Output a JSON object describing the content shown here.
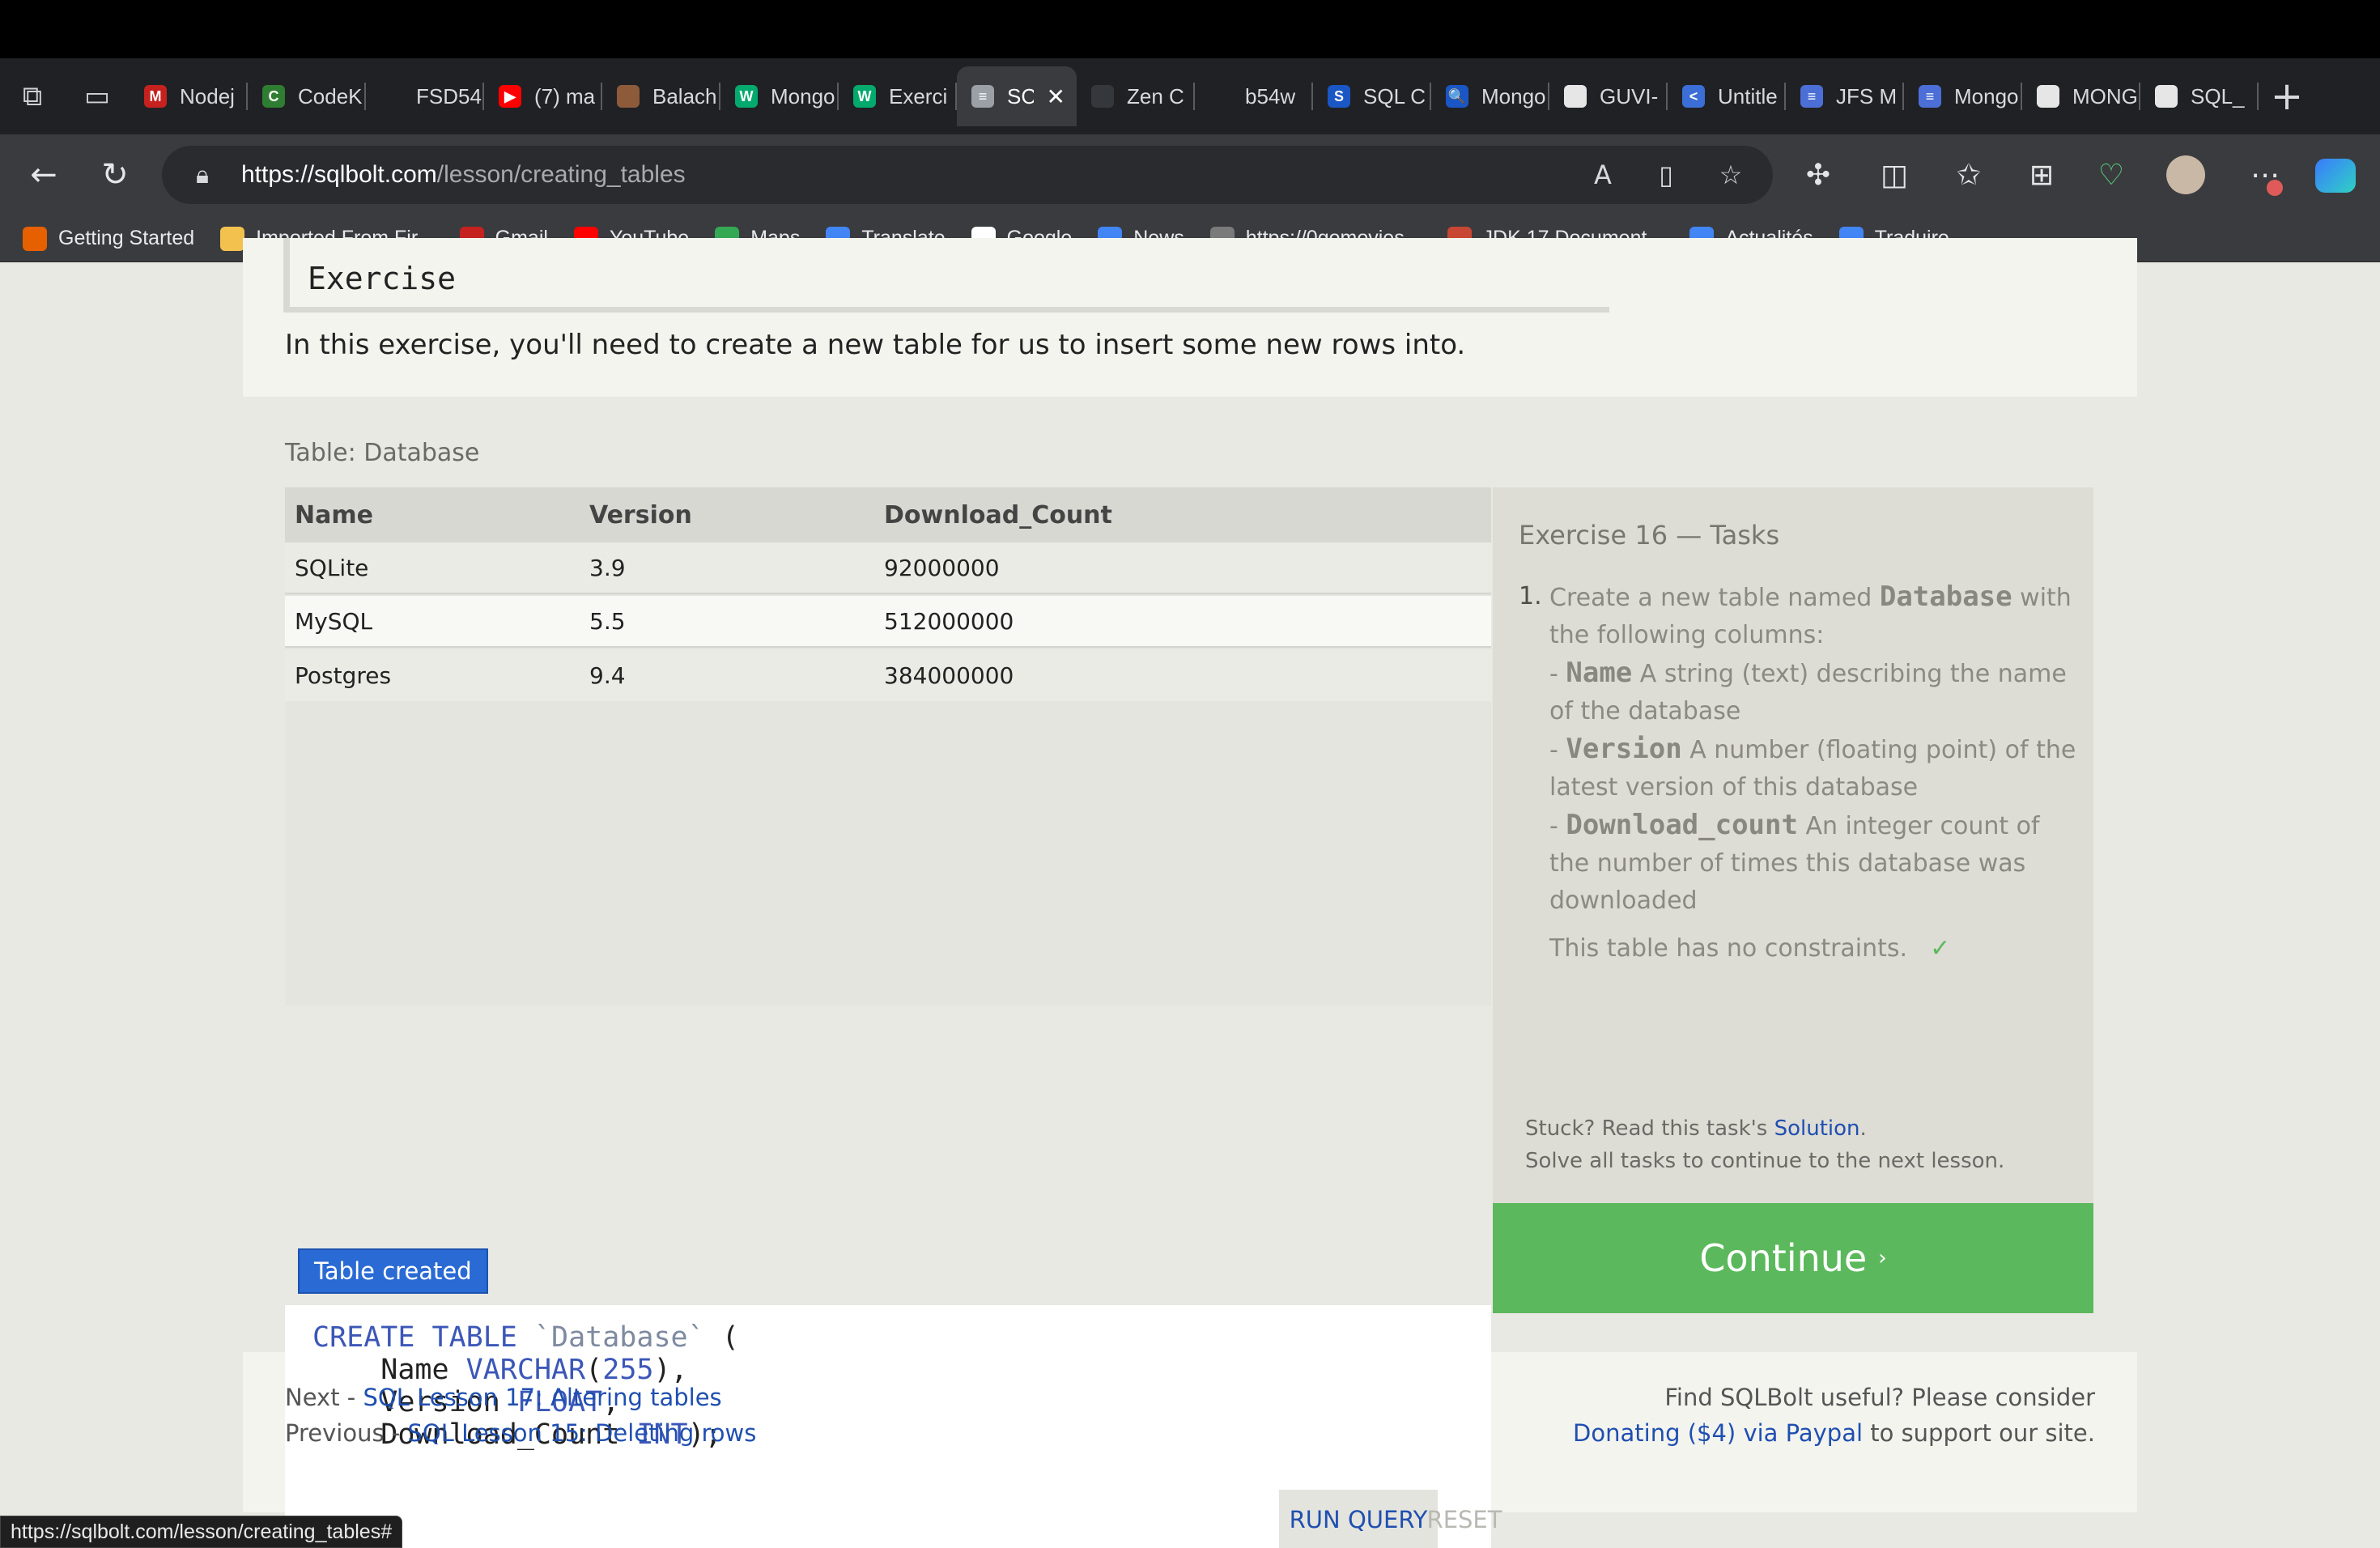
{
  "browser": {
    "tabs": [
      {
        "label": "Nodej",
        "icon": "gmail-icon",
        "color": "#c5221f",
        "glyph": "M"
      },
      {
        "label": "CodeK",
        "icon": "codekata-icon",
        "color": "#2f7d32",
        "glyph": "C"
      },
      {
        "label": "FSD54",
        "icon": "github-icon",
        "color": "#202124",
        "glyph": ""
      },
      {
        "label": "(7) ma",
        "icon": "youtube-icon",
        "color": "#ff0000",
        "glyph": "▶"
      },
      {
        "label": "Balach",
        "icon": "profile-icon",
        "color": "#8d5b3a",
        "glyph": ""
      },
      {
        "label": "Mongo",
        "icon": "w3-icon",
        "color": "#04aa6d",
        "glyph": "W"
      },
      {
        "label": "Exerci",
        "icon": "w3-icon",
        "color": "#04aa6d",
        "glyph": "W"
      },
      {
        "label": "SC",
        "icon": "database-icon",
        "color": "#9aa0a6",
        "glyph": "≡",
        "active": true
      },
      {
        "label": "Zen C",
        "icon": "zen-icon",
        "color": "#34373b",
        "glyph": ""
      },
      {
        "label": "b54w",
        "icon": "github-icon",
        "color": "#202124",
        "glyph": ""
      },
      {
        "label": "SQL C",
        "icon": "sql-icon",
        "color": "#1a56c4",
        "glyph": "S"
      },
      {
        "label": "Mongo",
        "icon": "search-icon",
        "color": "#1a56c4",
        "glyph": "🔍"
      },
      {
        "label": "GUVI-",
        "icon": "github-icon",
        "color": "#e6e6e6",
        "glyph": ""
      },
      {
        "label": "Untitle",
        "icon": "share-icon",
        "color": "#3b6ed6",
        "glyph": "<"
      },
      {
        "label": "JFS M",
        "icon": "docs-icon",
        "color": "#4b6fd6",
        "glyph": "≡"
      },
      {
        "label": "Mongo",
        "icon": "docs-icon",
        "color": "#4b6fd6",
        "glyph": "≡"
      },
      {
        "label": "MONG",
        "icon": "github-icon",
        "color": "#e6e6e6",
        "glyph": ""
      },
      {
        "label": "SQL_",
        "icon": "github-icon",
        "color": "#e6e6e6",
        "glyph": ""
      }
    ],
    "url_host": "https://sqlbolt.com",
    "url_path": "/lesson/creating_tables",
    "bookmarks": [
      {
        "label": "Getting Started",
        "icon": "firefox-icon",
        "color": "#e66000"
      },
      {
        "label": "Imported From Fir...",
        "icon": "folder-icon",
        "color": "#f2c14e"
      },
      {
        "label": "Gmail",
        "icon": "gmail-icon",
        "color": "#c5221f"
      },
      {
        "label": "YouTube",
        "icon": "youtube-icon",
        "color": "#ff0000"
      },
      {
        "label": "Maps",
        "icon": "maps-icon",
        "color": "#34a853"
      },
      {
        "label": "Translate",
        "icon": "translate-icon",
        "color": "#4285f4"
      },
      {
        "label": "Google",
        "icon": "google-icon",
        "color": "#ffffff"
      },
      {
        "label": "News",
        "icon": "news-icon",
        "color": "#4285f4"
      },
      {
        "label": "https://0gomovies...",
        "icon": "gomovies-icon",
        "color": "#7a7a7a"
      },
      {
        "label": "JDK 17 Document...",
        "icon": "oracle-icon",
        "color": "#c74634"
      },
      {
        "label": "Actualités",
        "icon": "news-icon",
        "color": "#4285f4"
      },
      {
        "label": "Traduire",
        "icon": "translate-icon",
        "color": "#4285f4"
      }
    ],
    "status_url": "https://sqlbolt.com/lesson/creating_tables#"
  },
  "exercise": {
    "heading": "Exercise",
    "intro": "In this exercise, you'll need to create a new table for us to insert some new rows into.",
    "table_caption": "Table: Database",
    "columns": [
      "Name",
      "Version",
      "Download_Count"
    ],
    "rows": [
      [
        "SQLite",
        "3.9",
        "92000000"
      ],
      [
        "MySQL",
        "5.5",
        "512000000"
      ],
      [
        "Postgres",
        "9.4",
        "384000000"
      ]
    ],
    "status": "Table created",
    "run_label": "RUN QUERY",
    "reset_label": "RESET"
  },
  "tasks": {
    "title": "Exercise 16 — Tasks",
    "task1_num": "1.",
    "task1_pre": "Create a new table named ",
    "task1_name": "Database",
    "task1_post": " with the following columns:",
    "col1_name": "Name",
    "col1_desc": " A string (text) describing the name of the database",
    "col2_name": "Version",
    "col2_desc": " A number (floating point) of the latest version of this database",
    "col3_name": "Download_count",
    "col3_desc": " An integer count of the number of times this database was downloaded",
    "task2": "This table has no constraints.",
    "check": "✓",
    "stuck_pre": "Stuck? Read this task's ",
    "stuck_link": "Solution",
    "stuck_post": ".",
    "stuck_line2": "Solve all tasks to continue to the next lesson.",
    "continue_label": "Continue"
  },
  "footer": {
    "next_prefix": "Next - ",
    "next_link": "SQL Lesson 17: Altering tables",
    "prev_prefix": "Previous - ",
    "prev_link": "SQL Lesson 15: Deleting rows",
    "support_line": "Find SQLBolt useful? Please consider",
    "donate_link": "Donating ($4) via Paypal",
    "support_post": " to support our site."
  },
  "colors": {
    "accent": "#1f4fb0",
    "continue": "#5cb85c",
    "status": "#2a6ad4"
  }
}
